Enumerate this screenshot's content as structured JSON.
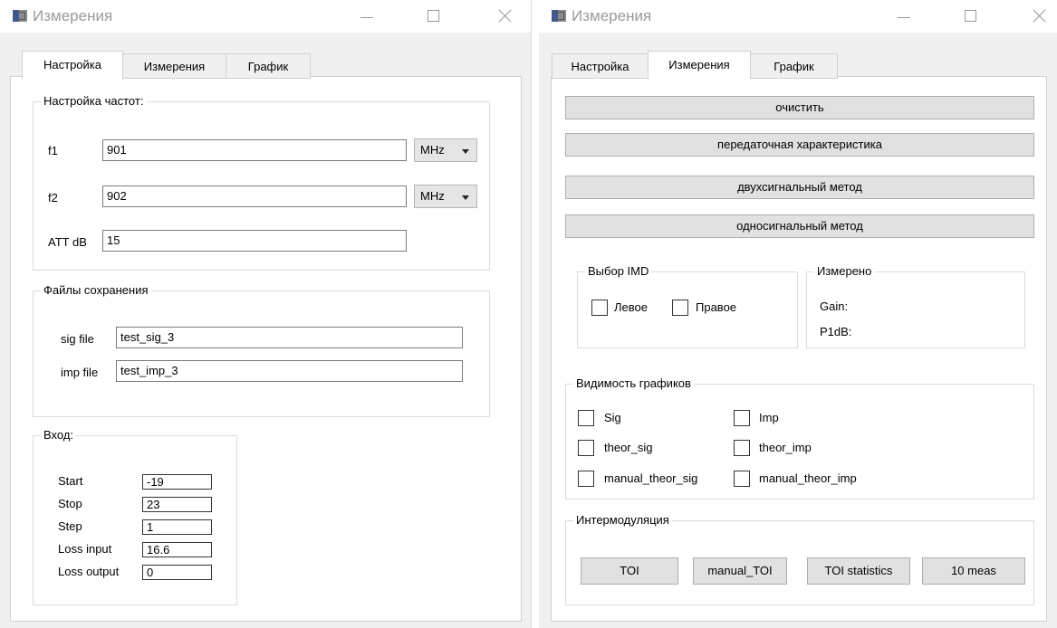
{
  "left_window": {
    "title": "Измерения",
    "tabs": [
      {
        "label": "Настройка",
        "active": true
      },
      {
        "label": "Измерения",
        "active": false
      },
      {
        "label": "График",
        "active": false
      }
    ],
    "frequency_group": {
      "title": "Настройка частот:",
      "f1_label": "f1",
      "f1_value": "901",
      "f1_unit": "MHz",
      "f2_label": "f2",
      "f2_value": "902",
      "f2_unit": "MHz",
      "att_label": "ATT dB",
      "att_value": "15"
    },
    "files_group": {
      "title": "Файлы сохранения",
      "sig_label": "sig file",
      "sig_value": "test_sig_3",
      "imp_label": "imp file",
      "imp_value": "test_imp_3"
    },
    "input_group": {
      "title": "Вход:",
      "rows": [
        {
          "label": "Start",
          "value": "-19"
        },
        {
          "label": "Stop",
          "value": "23"
        },
        {
          "label": "Step",
          "value": "1"
        },
        {
          "label": "Loss input",
          "value": "16.6"
        },
        {
          "label": "Loss output",
          "value": "0"
        }
      ]
    }
  },
  "right_window": {
    "title": "Измерения",
    "tabs": [
      {
        "label": "Настройка",
        "active": false
      },
      {
        "label": "Измерения",
        "active": true
      },
      {
        "label": "График",
        "active": false
      }
    ],
    "actions": {
      "clear": "очистить",
      "transfer": "передаточная характеристика",
      "two_signal": "двухсигнальный метод",
      "one_signal": "односигнальный метод"
    },
    "imd_group": {
      "title": "Выбор IMD",
      "left": {
        "label": "Левое",
        "checked": false
      },
      "right": {
        "label": "Правое",
        "checked": false
      }
    },
    "measured_group": {
      "title": "Измерено",
      "gain": "Gain:",
      "p1db": "P1dB:"
    },
    "visibility_group": {
      "title": "Видимость графиков",
      "items": [
        {
          "label": "Sig",
          "checked": false
        },
        {
          "label": "Imp",
          "checked": false
        },
        {
          "label": "theor_sig",
          "checked": false
        },
        {
          "label": "theor_imp",
          "checked": false
        },
        {
          "label": "manual_theor_sig",
          "checked": false
        },
        {
          "label": "manual_theor_imp",
          "checked": false
        }
      ]
    },
    "intermod_group": {
      "title": "Интермодуляция",
      "buttons": [
        "TOI",
        "manual_TOI",
        "TOI statistics",
        "10 meas"
      ]
    }
  },
  "icons": [
    "app-icon",
    "minimize-icon",
    "maximize-icon",
    "close-icon",
    "chevron-down-icon",
    "checkbox-icon"
  ],
  "colors": {
    "window_bg": "#f0f0f0",
    "panel_bg": "#ffffff",
    "button_bg": "#e1e1e1",
    "border": "#adadad"
  }
}
